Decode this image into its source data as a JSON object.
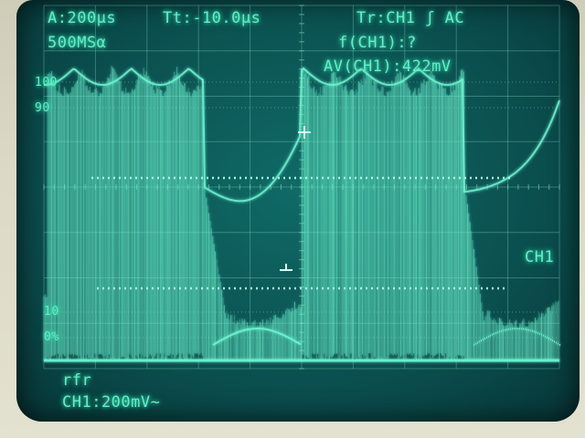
{
  "status_bar": {
    "timebase": "A:200µs",
    "trigger_time": "Tt:-10.0µs",
    "trigger": "Tr:CH1 ʃ AC",
    "sample_rate": "500MSα"
  },
  "measurements": {
    "frequency": "f(CH1):?",
    "average": "AV(CH1):422mV"
  },
  "reference_levels": {
    "level_100": "100",
    "level_90": "90",
    "level_10": "10",
    "level_0": "0%"
  },
  "channel_marker": "CH1",
  "mode_label": "rfr",
  "channel_setting": "CH1:200mV~",
  "colors": {
    "trace": "#6df5d0",
    "grid": "#7fd9c0",
    "background": "#0b4f4f"
  }
}
